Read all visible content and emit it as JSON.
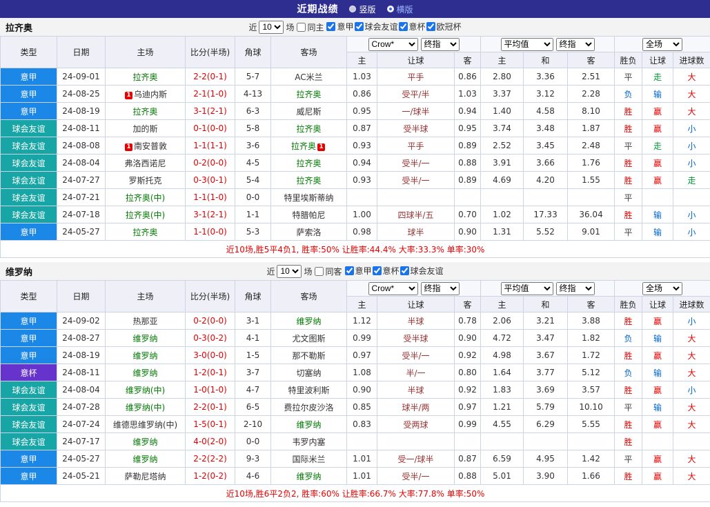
{
  "topbar": {
    "title": "近期战绩",
    "radios": [
      {
        "label": "竖版",
        "selected": false
      },
      {
        "label": "横版",
        "selected": true
      }
    ]
  },
  "labels": {
    "near": "近",
    "games": "场"
  },
  "table_headers": {
    "type": "类型",
    "date": "日期",
    "home": "主场",
    "score": "比分(半场)",
    "corner": "角球",
    "away": "客场",
    "odds_company": "Crow*",
    "final_index": "终指",
    "average": "平均值",
    "full": "全场",
    "odds_cols": [
      "主",
      "让球",
      "客"
    ],
    "avg_cols": [
      "主",
      "和",
      "客"
    ],
    "full_cols": [
      "胜负",
      "让球",
      "进球数"
    ]
  },
  "colors": {
    "topbar": "#2e2e90",
    "focus_team": "#007a00",
    "score": "#e60000",
    "handicap": "#993333",
    "leagues": {
      "意甲": "#1b87e6",
      "球会友谊": "#18a5a5",
      "意杯": "#6633cc"
    },
    "results": {
      "胜": "#e60000",
      "赢": "#e60000",
      "大": "#e60000",
      "负": "#0066cc",
      "输": "#0066cc",
      "小": "#0066cc",
      "走": "#009933",
      "平": "#444444"
    }
  },
  "sections": [
    {
      "team": "拉齐奥",
      "filter": {
        "count": "10",
        "same_label": "同主",
        "same_checked": false,
        "leagues": [
          {
            "label": "意甲",
            "checked": true
          },
          {
            "label": "球会友谊",
            "checked": true
          },
          {
            "label": "意杯",
            "checked": true
          },
          {
            "label": "欧冠杯",
            "checked": true
          }
        ]
      },
      "rows": [
        {
          "type": "意甲",
          "date": "24-09-01",
          "home": "拉齐奥",
          "home_focus": true,
          "home_badge": "",
          "score": "2-2(0-1)",
          "corner": "5-7",
          "away": "AC米兰",
          "away_focus": false,
          "away_badge": "",
          "odds": [
            "1.03",
            "平手",
            "0.86"
          ],
          "avg": [
            "2.80",
            "3.36",
            "2.51"
          ],
          "results": [
            "平",
            "走",
            "大"
          ]
        },
        {
          "type": "意甲",
          "date": "24-08-25",
          "home": "乌迪内斯",
          "home_focus": false,
          "home_badge": "1",
          "score": "2-1(1-0)",
          "corner": "4-13",
          "away": "拉齐奥",
          "away_focus": true,
          "away_badge": "",
          "odds": [
            "0.86",
            "受平/半",
            "1.03"
          ],
          "avg": [
            "3.37",
            "3.12",
            "2.28"
          ],
          "results": [
            "负",
            "输",
            "大"
          ]
        },
        {
          "type": "意甲",
          "date": "24-08-19",
          "home": "拉齐奥",
          "home_focus": true,
          "home_badge": "",
          "score": "3-1(2-1)",
          "corner": "6-3",
          "away": "威尼斯",
          "away_focus": false,
          "away_badge": "",
          "odds": [
            "0.95",
            "一/球半",
            "0.94"
          ],
          "avg": [
            "1.40",
            "4.58",
            "8.10"
          ],
          "results": [
            "胜",
            "赢",
            "大"
          ]
        },
        {
          "type": "球会友谊",
          "date": "24-08-11",
          "home": "加的斯",
          "home_focus": false,
          "home_badge": "",
          "score": "0-1(0-0)",
          "corner": "5-8",
          "away": "拉齐奥",
          "away_focus": true,
          "away_badge": "",
          "odds": [
            "0.87",
            "受半球",
            "0.95"
          ],
          "avg": [
            "3.74",
            "3.48",
            "1.87"
          ],
          "results": [
            "胜",
            "赢",
            "小"
          ]
        },
        {
          "type": "球会友谊",
          "date": "24-08-08",
          "home": "南安普敦",
          "home_focus": false,
          "home_badge": "1",
          "score": "1-1(1-1)",
          "corner": "3-6",
          "away": "拉齐奥",
          "away_focus": true,
          "away_badge": "1",
          "odds": [
            "0.93",
            "平手",
            "0.89"
          ],
          "avg": [
            "2.52",
            "3.45",
            "2.48"
          ],
          "results": [
            "平",
            "走",
            "小"
          ]
        },
        {
          "type": "球会友谊",
          "date": "24-08-04",
          "home": "弗洛西诺尼",
          "home_focus": false,
          "home_badge": "",
          "score": "0-2(0-0)",
          "corner": "4-5",
          "away": "拉齐奥",
          "away_focus": true,
          "away_badge": "",
          "odds": [
            "0.94",
            "受半/一",
            "0.88"
          ],
          "avg": [
            "3.91",
            "3.66",
            "1.76"
          ],
          "results": [
            "胜",
            "赢",
            "小"
          ]
        },
        {
          "type": "球会友谊",
          "date": "24-07-27",
          "home": "罗斯托克",
          "home_focus": false,
          "home_badge": "",
          "score": "0-3(0-1)",
          "corner": "5-4",
          "away": "拉齐奥",
          "away_focus": true,
          "away_badge": "",
          "odds": [
            "0.93",
            "受半/一",
            "0.89"
          ],
          "avg": [
            "4.69",
            "4.20",
            "1.55"
          ],
          "results": [
            "胜",
            "赢",
            "走"
          ]
        },
        {
          "type": "球会友谊",
          "date": "24-07-21",
          "home": "拉齐奥(中)",
          "home_focus": true,
          "home_badge": "",
          "score": "1-1(1-0)",
          "corner": "0-0",
          "away": "特里埃斯蒂纳",
          "away_focus": false,
          "away_badge": "",
          "odds": [
            "",
            "",
            ""
          ],
          "avg": [
            "",
            "",
            ""
          ],
          "results": [
            "平",
            "",
            ""
          ]
        },
        {
          "type": "球会友谊",
          "date": "24-07-18",
          "home": "拉齐奥(中)",
          "home_focus": true,
          "home_badge": "",
          "score": "3-1(2-1)",
          "corner": "1-1",
          "away": "特腊帕尼",
          "away_focus": false,
          "away_badge": "",
          "odds": [
            "1.00",
            "四球半/五",
            "0.70"
          ],
          "avg": [
            "1.02",
            "17.33",
            "36.04"
          ],
          "results": [
            "胜",
            "输",
            "小"
          ]
        },
        {
          "type": "意甲",
          "date": "24-05-27",
          "home": "拉齐奥",
          "home_focus": true,
          "home_badge": "",
          "score": "1-1(0-0)",
          "corner": "5-3",
          "away": "萨索洛",
          "away_focus": false,
          "away_badge": "",
          "odds": [
            "0.98",
            "球半",
            "0.90"
          ],
          "avg": [
            "1.31",
            "5.52",
            "9.01"
          ],
          "results": [
            "平",
            "输",
            "小"
          ]
        }
      ],
      "summary": "近10场,胜5平4负1, 胜率:50% 让胜率:44.4% 大率:33.3% 单率:30%"
    },
    {
      "team": "维罗纳",
      "filter": {
        "count": "10",
        "same_label": "同客",
        "same_checked": false,
        "leagues": [
          {
            "label": "意甲",
            "checked": true
          },
          {
            "label": "意杯",
            "checked": true
          },
          {
            "label": "球会友谊",
            "checked": true
          }
        ]
      },
      "rows": [
        {
          "type": "意甲",
          "date": "24-09-02",
          "home": "热那亚",
          "home_focus": false,
          "home_badge": "",
          "score": "0-2(0-0)",
          "corner": "3-1",
          "away": "维罗纳",
          "away_focus": true,
          "away_badge": "",
          "odds": [
            "1.12",
            "半球",
            "0.78"
          ],
          "avg": [
            "2.06",
            "3.21",
            "3.88"
          ],
          "results": [
            "胜",
            "赢",
            "小"
          ]
        },
        {
          "type": "意甲",
          "date": "24-08-27",
          "home": "维罗纳",
          "home_focus": true,
          "home_badge": "",
          "score": "0-3(0-2)",
          "corner": "4-1",
          "away": "尤文图斯",
          "away_focus": false,
          "away_badge": "",
          "odds": [
            "0.99",
            "受半球",
            "0.90"
          ],
          "avg": [
            "4.72",
            "3.47",
            "1.82"
          ],
          "results": [
            "负",
            "输",
            "大"
          ]
        },
        {
          "type": "意甲",
          "date": "24-08-19",
          "home": "维罗纳",
          "home_focus": true,
          "home_badge": "",
          "score": "3-0(0-0)",
          "corner": "1-5",
          "away": "那不勒斯",
          "away_focus": false,
          "away_badge": "",
          "odds": [
            "0.97",
            "受半/一",
            "0.92"
          ],
          "avg": [
            "4.98",
            "3.67",
            "1.72"
          ],
          "results": [
            "胜",
            "赢",
            "大"
          ]
        },
        {
          "type": "意杯",
          "date": "24-08-11",
          "home": "维罗纳",
          "home_focus": true,
          "home_badge": "",
          "score": "1-2(0-1)",
          "corner": "3-7",
          "away": "切塞纳",
          "away_focus": false,
          "away_badge": "",
          "odds": [
            "1.08",
            "半/一",
            "0.80"
          ],
          "avg": [
            "1.64",
            "3.77",
            "5.12"
          ],
          "results": [
            "负",
            "输",
            "大"
          ]
        },
        {
          "type": "球会友谊",
          "date": "24-08-04",
          "home": "维罗纳(中)",
          "home_focus": true,
          "home_badge": "",
          "score": "1-0(1-0)",
          "corner": "4-7",
          "away": "特里波利斯",
          "away_focus": false,
          "away_badge": "",
          "odds": [
            "0.90",
            "半球",
            "0.92"
          ],
          "avg": [
            "1.83",
            "3.69",
            "3.57"
          ],
          "results": [
            "胜",
            "赢",
            "小"
          ]
        },
        {
          "type": "球会友谊",
          "date": "24-07-28",
          "home": "维罗纳(中)",
          "home_focus": true,
          "home_badge": "",
          "score": "2-2(0-1)",
          "corner": "6-5",
          "away": "费拉尔皮沙洛",
          "away_focus": false,
          "away_badge": "",
          "odds": [
            "0.85",
            "球半/两",
            "0.97"
          ],
          "avg": [
            "1.21",
            "5.79",
            "10.10"
          ],
          "results": [
            "平",
            "输",
            "大"
          ]
        },
        {
          "type": "球会友谊",
          "date": "24-07-24",
          "home": "维德思维罗纳(中)",
          "home_focus": false,
          "home_badge": "",
          "score": "1-5(0-1)",
          "corner": "2-10",
          "away": "维罗纳",
          "away_focus": true,
          "away_badge": "",
          "odds": [
            "0.83",
            "受两球",
            "0.99"
          ],
          "avg": [
            "4.55",
            "6.29",
            "5.55"
          ],
          "results": [
            "胜",
            "赢",
            "大"
          ]
        },
        {
          "type": "球会友谊",
          "date": "24-07-17",
          "home": "维罗纳",
          "home_focus": true,
          "home_badge": "",
          "score": "4-0(2-0)",
          "corner": "0-0",
          "away": "韦罗内塞",
          "away_focus": false,
          "away_badge": "",
          "odds": [
            "",
            "",
            ""
          ],
          "avg": [
            "",
            "",
            ""
          ],
          "results": [
            "胜",
            "",
            ""
          ]
        },
        {
          "type": "意甲",
          "date": "24-05-27",
          "home": "维罗纳",
          "home_focus": true,
          "home_badge": "",
          "score": "2-2(2-2)",
          "corner": "9-3",
          "away": "国际米兰",
          "away_focus": false,
          "away_badge": "",
          "odds": [
            "1.01",
            "受一/球半",
            "0.87"
          ],
          "avg": [
            "6.59",
            "4.95",
            "1.42"
          ],
          "results": [
            "平",
            "赢",
            "大"
          ]
        },
        {
          "type": "意甲",
          "date": "24-05-21",
          "home": "萨勒尼塔纳",
          "home_focus": false,
          "home_badge": "",
          "score": "1-2(0-2)",
          "corner": "4-6",
          "away": "维罗纳",
          "away_focus": true,
          "away_badge": "",
          "odds": [
            "1.01",
            "受半/一",
            "0.88"
          ],
          "avg": [
            "5.01",
            "3.90",
            "1.66"
          ],
          "results": [
            "胜",
            "赢",
            "大"
          ]
        }
      ],
      "summary": "近10场,胜6平2负2, 胜率:60% 让胜率:66.7% 大率:77.8% 单率:50%"
    }
  ]
}
